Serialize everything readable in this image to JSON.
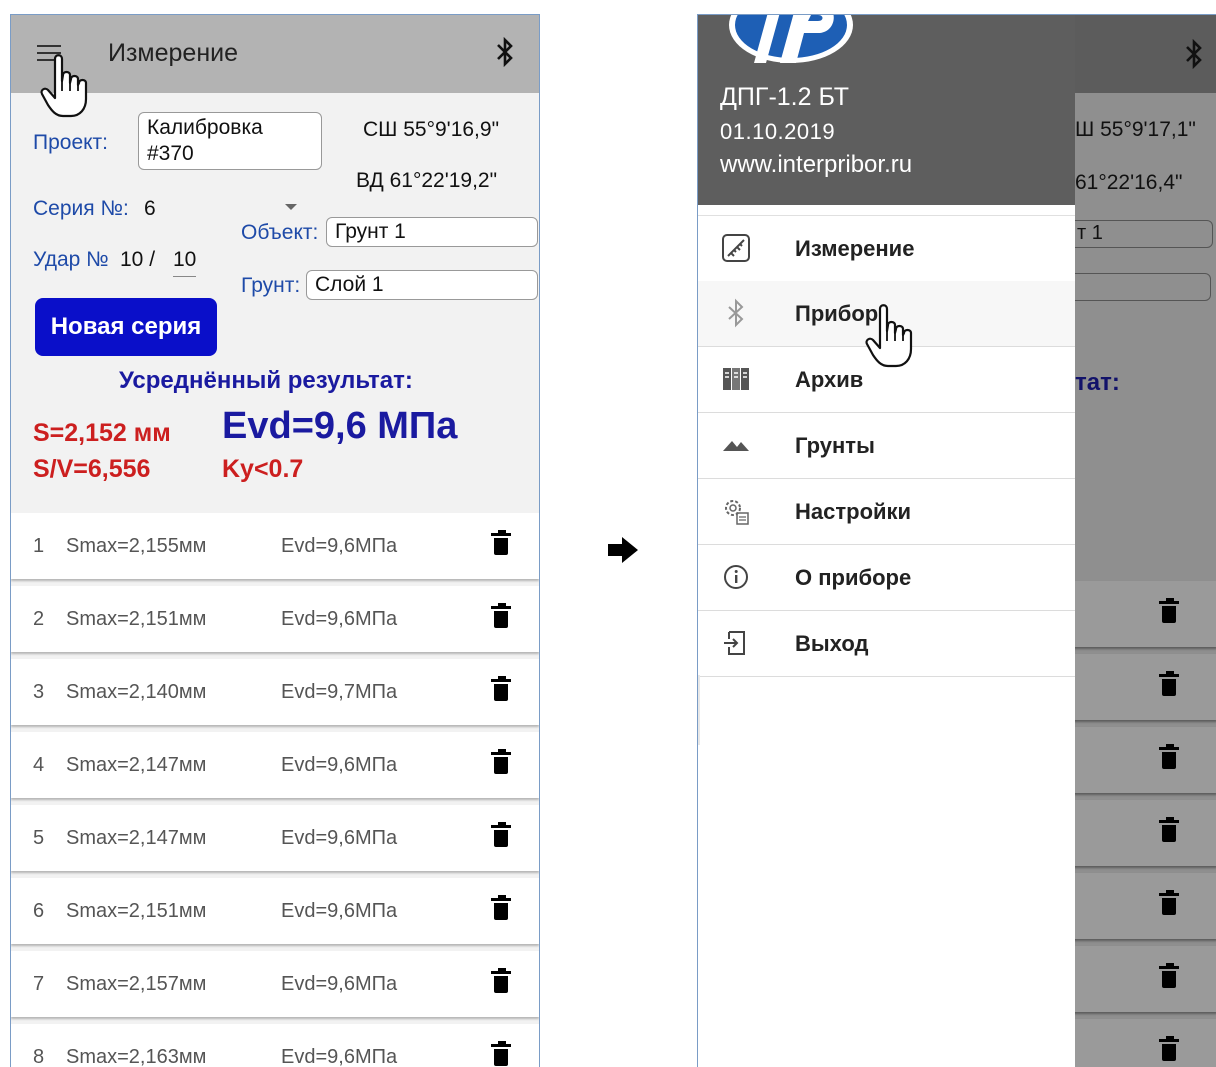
{
  "left": {
    "title": "Измерение",
    "project_label": "Проект:",
    "project_value_line1": "Калибровка",
    "project_value_line2": "#370",
    "gps_lat": "СШ 55°9'16,9\"",
    "gps_lon": "ВД 61°22'19,2\"",
    "series_label": "Серия №:",
    "series_value": "6",
    "object_label": "Объект:",
    "object_value": "Грунт 1",
    "hit_label": "Удар №",
    "hit_value": "10 /",
    "hit_total": "10",
    "soil_label": "Грунт:",
    "soil_value": "Слой 1",
    "new_series_button": "Новая серия",
    "avg_title": "Усреднённый результат:",
    "s_value": "S=2,152 мм",
    "sv_value": "S/V=6,556",
    "evd_value": "Evd=9,6 МПа",
    "ky_value": "Ky<0.7",
    "rows": [
      {
        "n": "1",
        "smax": "Smax=2,155мм",
        "evd": "Evd=9,6МПа"
      },
      {
        "n": "2",
        "smax": "Smax=2,151мм",
        "evd": "Evd=9,6МПа"
      },
      {
        "n": "3",
        "smax": "Smax=2,140мм",
        "evd": "Evd=9,7МПа"
      },
      {
        "n": "4",
        "smax": "Smax=2,147мм",
        "evd": "Evd=9,6МПа"
      },
      {
        "n": "5",
        "smax": "Smax=2,147мм",
        "evd": "Evd=9,6МПа"
      },
      {
        "n": "6",
        "smax": "Smax=2,151мм",
        "evd": "Evd=9,6МПа"
      },
      {
        "n": "7",
        "smax": "Smax=2,157мм",
        "evd": "Evd=9,6МПа"
      },
      {
        "n": "8",
        "smax": "Smax=2,163мм",
        "evd": "Evd=9,6МПа"
      }
    ]
  },
  "arrow": "➡",
  "right": {
    "behind_lat": "Ш 55°9'17,1\"",
    "behind_lon": "61°22'16,4\"",
    "behind_field": "т 1",
    "behind_result": "тат:",
    "drawer": {
      "device": "ДПГ-1.2 БТ",
      "date": "01.10.2019",
      "url": "www.interpribor.ru",
      "items": [
        {
          "label": "Измерение",
          "icon": "ruler-icon"
        },
        {
          "label": "Прибор",
          "icon": "bluetooth-icon"
        },
        {
          "label": "Архив",
          "icon": "archive-icon"
        },
        {
          "label": "Грунты",
          "icon": "mountains-icon"
        },
        {
          "label": "Настройки",
          "icon": "gear-icon"
        },
        {
          "label": "О приборе",
          "icon": "info-icon"
        },
        {
          "label": "Выход",
          "icon": "exit-icon"
        }
      ]
    }
  },
  "colors": {
    "appbar": "#b3b3b3",
    "button_blue": "#0a0fc9",
    "label_blue": "#1e4aa8",
    "result_red": "#cc1f1f",
    "drawer_header": "#5e5e5e"
  }
}
